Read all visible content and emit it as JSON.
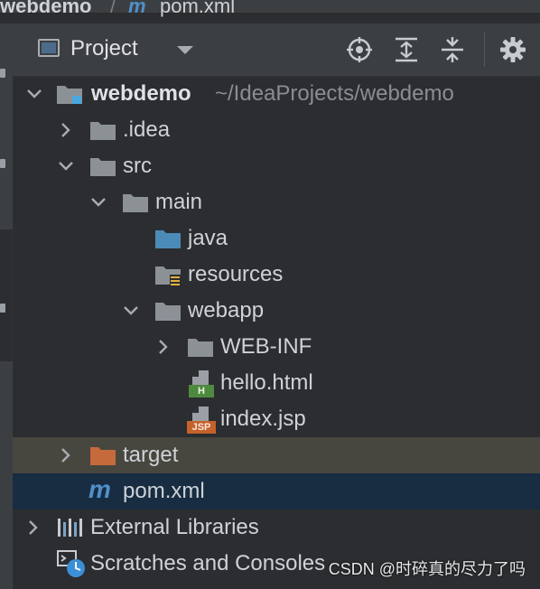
{
  "breadcrumb": {
    "project": "webdemo",
    "separator": "/",
    "maven_glyph": "m",
    "file": "pom.xml"
  },
  "toolwindow": {
    "title": "Project",
    "actions": [
      "locate-icon",
      "expand-all-icon",
      "collapse-all-icon",
      "gear-icon"
    ]
  },
  "tree": {
    "root": {
      "name": "webdemo",
      "path": "~/IdeaProjects/webdemo"
    },
    "idea": ".idea",
    "src": "src",
    "main": "main",
    "java": "java",
    "resources": "resources",
    "webapp": "webapp",
    "webinf": "WEB-INF",
    "hello": "hello.html",
    "hello_badge": "H",
    "index": "index.jsp",
    "index_badge": "JSP",
    "target": "target",
    "pom": "pom.xml",
    "pom_glyph": "m",
    "external": "External Libraries",
    "scratches": "Scratches and Consoles"
  },
  "watermark": "CSDN @时碎真的尽力了吗",
  "colors": {
    "background": "#2b2d30",
    "selected_row": "#182c42",
    "target_row": "#47463f",
    "folder": "#8c9196",
    "source_folder": "#4a8bb8",
    "excluded_folder": "#c56a3a",
    "maven": "#4f90c9"
  }
}
